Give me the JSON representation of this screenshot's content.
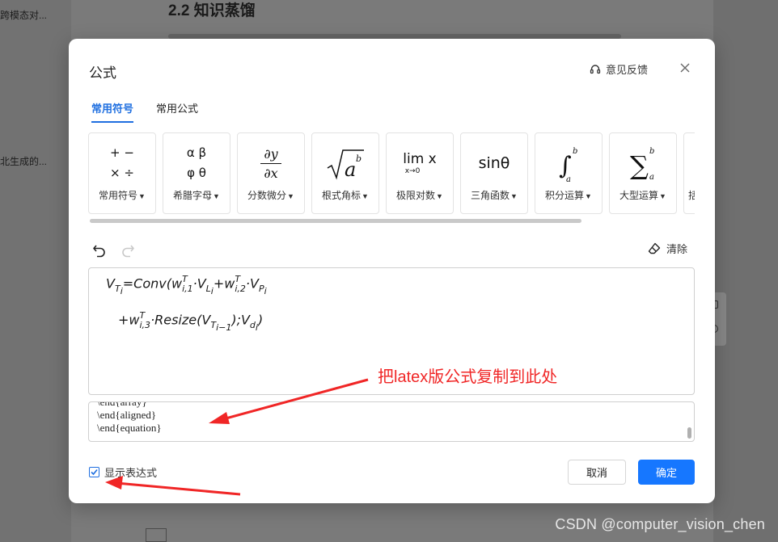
{
  "background": {
    "heading": "2.2  知识蒸馏",
    "left_snippets": [
      "跨模态对...",
      "北生成的..."
    ]
  },
  "watermark": "CSDN @computer_vision_chen",
  "dialog": {
    "title": "公式",
    "feedback_label": "意见反馈",
    "tabs": [
      {
        "label": "常用符号",
        "active": true
      },
      {
        "label": "常用公式",
        "active": false
      }
    ],
    "symbol_groups": [
      {
        "label": "常用符号",
        "icon": "basic-operators"
      },
      {
        "label": "希腊字母",
        "icon": "greek-letters"
      },
      {
        "label": "分数微分",
        "icon": "fraction-derivative"
      },
      {
        "label": "根式角标",
        "icon": "radical-script"
      },
      {
        "label": "极限对数",
        "icon": "limit-log"
      },
      {
        "label": "三角函数",
        "icon": "trig-function"
      },
      {
        "label": "积分运算",
        "icon": "integral"
      },
      {
        "label": "大型运算",
        "icon": "large-operator"
      },
      {
        "label": "括",
        "icon": "bracket"
      }
    ],
    "symbol_glyphs": {
      "basic": [
        "+  −",
        "×  ÷"
      ],
      "greek": [
        "α  β",
        "φ  θ"
      ],
      "fraction": [
        "∂y",
        "∂x"
      ],
      "radical": "a",
      "radical_sup": "b",
      "limit": "lim x",
      "limit_sub": "x→0",
      "trig": "sinθ",
      "integral_upper": "b",
      "integral_lower": "a",
      "sum_upper": "b",
      "sum_lower": "a"
    },
    "clear_label": "清除",
    "formula_line1": {
      "V": "V",
      "T": "T",
      "i": "i",
      "eq": "=Conv(",
      "w": "w",
      "sup_T": "T",
      "sub_i1": "i,1",
      "dot_V": "·V",
      "L": "L",
      "Li": "i",
      "plus_w": "+w",
      "sub_i2": "i,2",
      "dot_VP": "·V",
      "P": "P",
      "Pi": "i"
    },
    "formula_line2": {
      "plus_w": "+w",
      "sup_T": "T",
      "sub_i3": "i,3",
      "resize": "·Resize(V",
      "T": "T",
      "sub_im1": "i−1",
      "close_semi": ");V",
      "d": "d",
      "di": "i",
      "close": ")"
    },
    "latex_lines": [
      "\\end{array}",
      "\\end{aligned}",
      "\\end{equation}"
    ],
    "show_expression_label": "显示表达式",
    "show_expression_checked": true,
    "cancel_label": "取消",
    "ok_label": "确定"
  },
  "annotation": {
    "text": "把latex版公式复制到此处",
    "color": "#f02626"
  },
  "colors": {
    "accent": "#1f6fe0",
    "primary_button": "#1677ff"
  }
}
